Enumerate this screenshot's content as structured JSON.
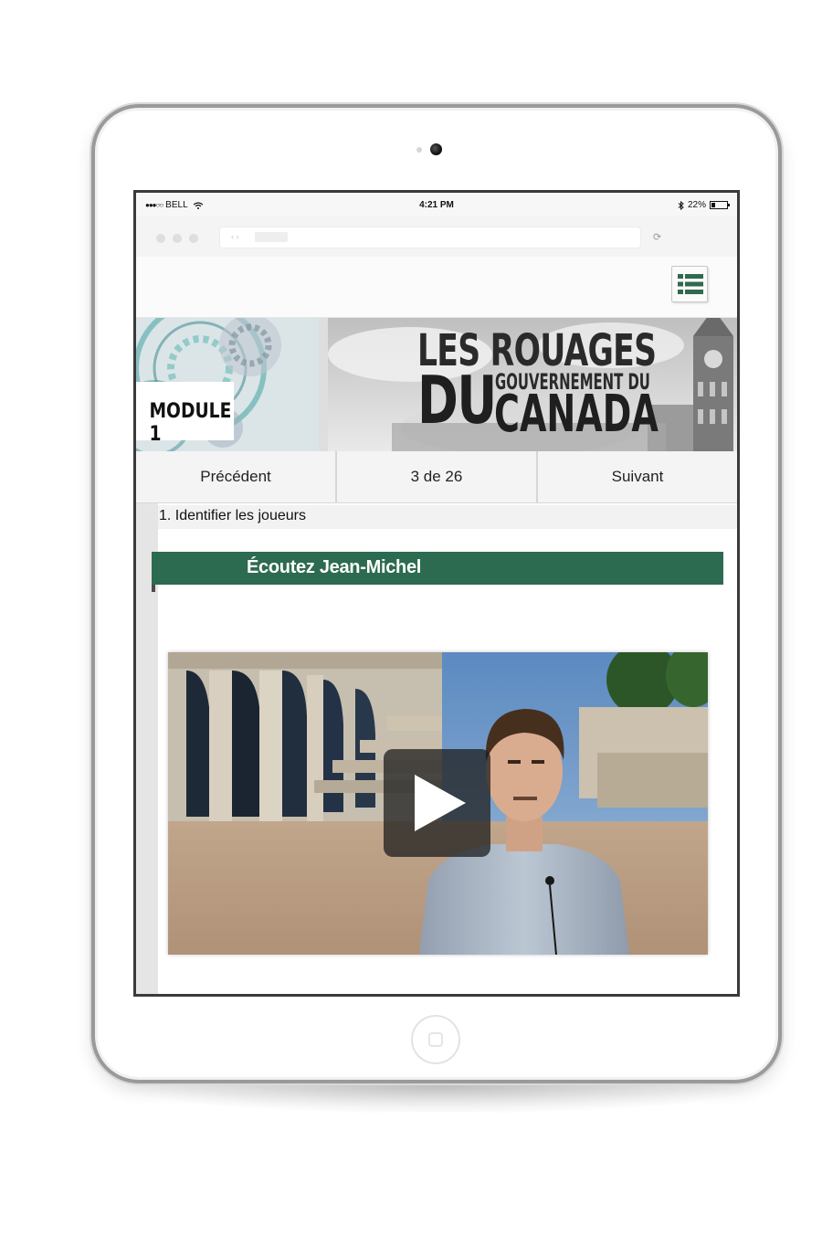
{
  "status_bar": {
    "carrier": "BELL",
    "time": "4:21 PM",
    "battery": "22%"
  },
  "banner": {
    "module_label": "MODULE 1",
    "title_line1": "LES ROUAGES",
    "title_du": "DU",
    "title_gouvernement": "GOUVERNEMENT DU",
    "title_canada": "CANADA"
  },
  "pager": {
    "previous_label": "Précédent",
    "position_label": "3 de 26",
    "next_label": "Suivant"
  },
  "section": {
    "title": "1. Identifier les joueurs",
    "heading": "Écoutez Jean-Michel"
  },
  "colors": {
    "accent_green": "#2d6b50",
    "menu_icon_green": "#2f6a4e"
  },
  "icons": {
    "menu": "list-menu-icon",
    "play": "play-icon",
    "wifi": "wifi-icon",
    "battery": "battery-icon",
    "bluetooth": "bluetooth-icon",
    "reload": "reload-icon"
  }
}
